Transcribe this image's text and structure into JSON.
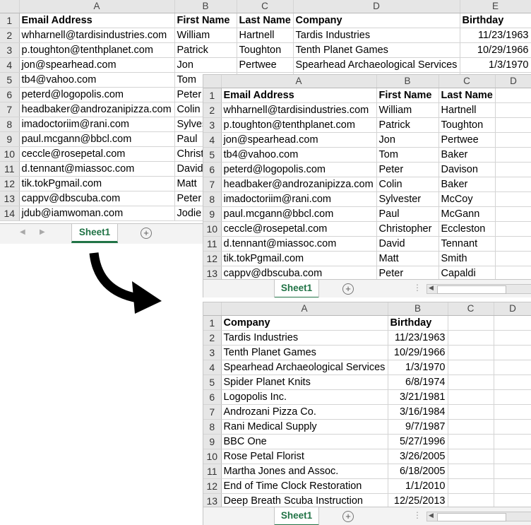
{
  "columns": {
    "A": "A",
    "B": "B",
    "C": "C",
    "D": "D",
    "E": "E"
  },
  "sheet_tab": "Sheet1",
  "add_sheet_symbol": "+",
  "nav_prev": "◀",
  "nav_next": "▶",
  "scroll_arrow": "◀",
  "dots": "⋮",
  "arrow_color": "#000000",
  "tab_color": "#217346",
  "original": {
    "headers": [
      "Email Address",
      "First Name",
      "Last Name",
      "Company",
      "Birthday"
    ],
    "rows": [
      [
        "whharnell@tardisindustries.com",
        "William",
        "Hartnell",
        "Tardis Industries",
        "11/23/1963"
      ],
      [
        "p.toughton@tenthplanet.com",
        "Patrick",
        "Toughton",
        "Tenth Planet Games",
        "10/29/1966"
      ],
      [
        "jon@spearhead.com",
        "Jon",
        "Pertwee",
        "Spearhead Archaeological Services",
        "1/3/1970"
      ],
      [
        "tb4@vahoo.com",
        "Tom",
        "",
        "",
        ""
      ],
      [
        "peterd@logopolis.com",
        "Peter",
        "",
        "",
        ""
      ],
      [
        "headbaker@androzanipizza.com",
        "Colin",
        "",
        "",
        ""
      ],
      [
        "imadoctoriim@rani.com",
        "Sylves",
        "",
        "",
        ""
      ],
      [
        "paul.mcgann@bbcl.com",
        "Paul",
        "",
        "",
        ""
      ],
      [
        "ceccle@rosepetal.com",
        "Christ",
        "",
        "",
        ""
      ],
      [
        "d.tennant@miassoc.com",
        "David",
        "",
        "",
        ""
      ],
      [
        "tik.tokPgmail.com",
        "Matt",
        "",
        "",
        ""
      ],
      [
        "cappv@dbscuba.com",
        "Peter",
        "",
        "",
        ""
      ],
      [
        "jdub@iamwoman.com",
        "Jodie",
        "",
        "",
        ""
      ]
    ]
  },
  "split1": {
    "headers": [
      "Email Address",
      "First Name",
      "Last Name"
    ],
    "rows": [
      [
        "whharnell@tardisindustries.com",
        "William",
        "Hartnell"
      ],
      [
        "p.toughton@tenthplanet.com",
        "Patrick",
        "Toughton"
      ],
      [
        "jon@spearhead.com",
        "Jon",
        "Pertwee"
      ],
      [
        "tb4@vahoo.com",
        "Tom",
        "Baker"
      ],
      [
        "peterd@logopolis.com",
        "Peter",
        "Davison"
      ],
      [
        "headbaker@androzanipizza.com",
        "Colin",
        "Baker"
      ],
      [
        "imadoctoriim@rani.com",
        "Sylvester",
        "McCoy"
      ],
      [
        "paul.mcgann@bbcl.com",
        "Paul",
        "McGann"
      ],
      [
        "ceccle@rosepetal.com",
        "Christopher",
        "Eccleston"
      ],
      [
        "d.tennant@miassoc.com",
        "David",
        "Tennant"
      ],
      [
        "tik.tokPgmail.com",
        "Matt",
        "Smith"
      ],
      [
        "cappv@dbscuba.com",
        "Peter",
        "Capaldi"
      ]
    ]
  },
  "split2": {
    "headers": [
      "Company",
      "Birthday"
    ],
    "rows": [
      [
        "Tardis Industries",
        "11/23/1963"
      ],
      [
        "Tenth Planet Games",
        "10/29/1966"
      ],
      [
        "Spearhead Archaeological Services",
        "1/3/1970"
      ],
      [
        "Spider Planet Knits",
        "6/8/1974"
      ],
      [
        "Logopolis Inc.",
        "3/21/1981"
      ],
      [
        "Androzani Pizza Co.",
        "3/16/1984"
      ],
      [
        "Rani Medical Supply",
        "9/7/1987"
      ],
      [
        "BBC One",
        "5/27/1996"
      ],
      [
        "Rose Petal Florist",
        "3/26/2005"
      ],
      [
        "Martha Jones and Assoc.",
        "6/18/2005"
      ],
      [
        "End of Time Clock Restoration",
        "1/1/2010"
      ],
      [
        "Deep Breath Scuba Instruction",
        "12/25/2013"
      ]
    ]
  }
}
